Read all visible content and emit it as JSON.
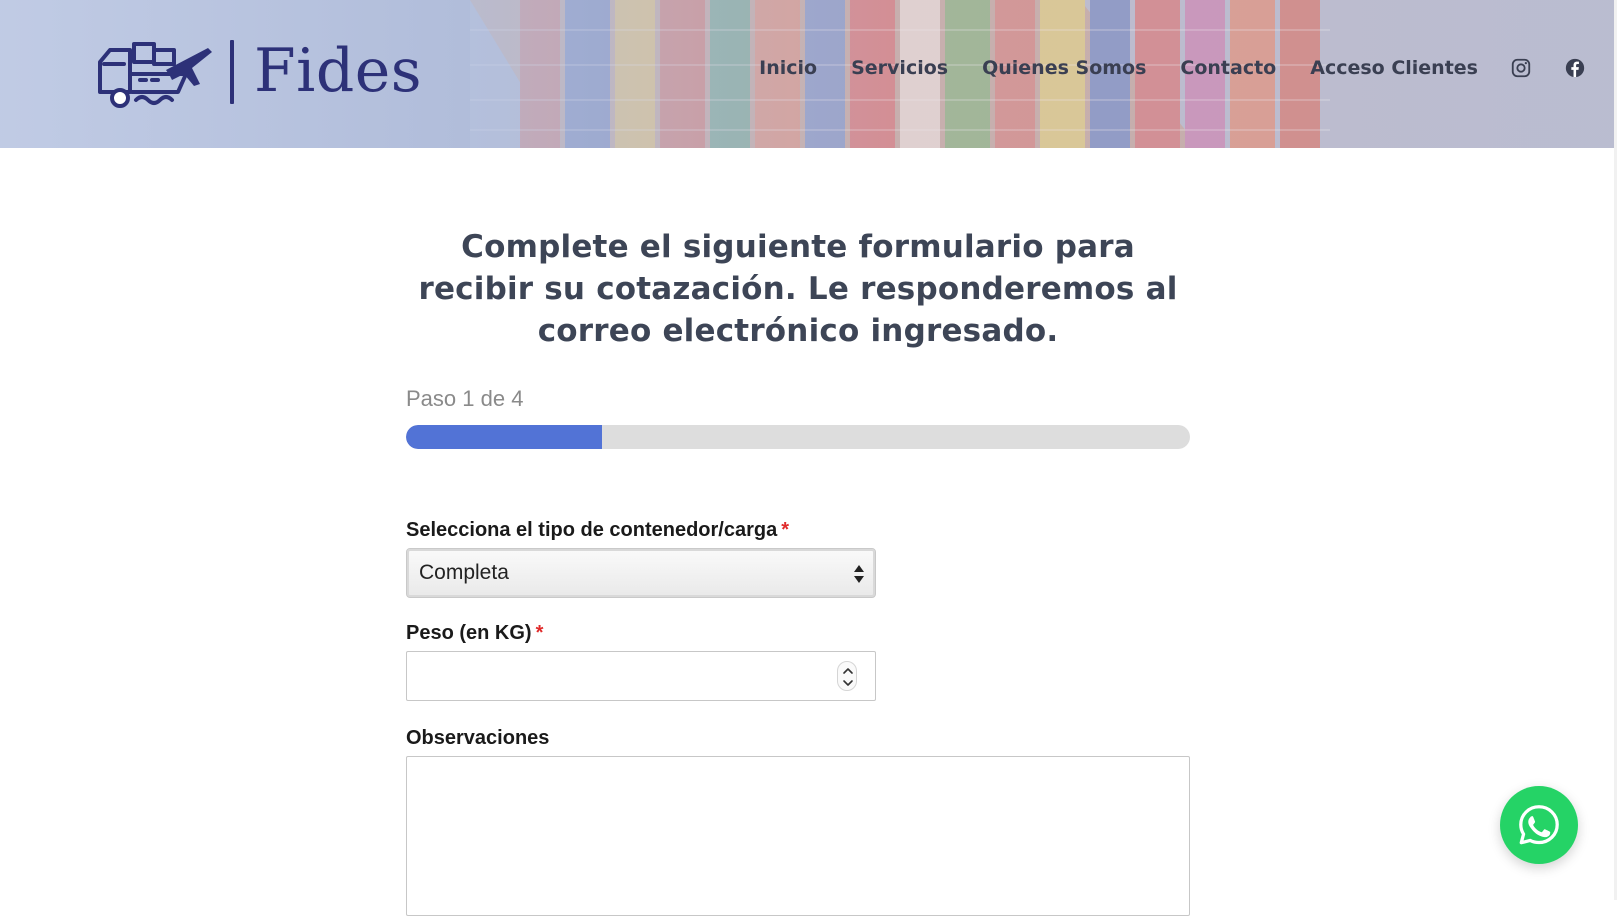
{
  "brand": {
    "name": "Fides",
    "primary_color": "#2d3178",
    "logo_icon": "truck-ship-plane-logo"
  },
  "nav": {
    "items": [
      {
        "label": "Inicio"
      },
      {
        "label": "Servicios"
      },
      {
        "label": "Quienes Somos"
      },
      {
        "label": "Contacto"
      },
      {
        "label": "Acceso Clientes"
      }
    ],
    "social_icons": [
      "instagram-icon",
      "facebook-icon"
    ]
  },
  "form": {
    "intro": "Complete el siguiente formulario para recibir su cotazación. Le responderemos al correo electrónico ingresado.",
    "step_label": "Paso 1 de 4",
    "progress_fraction": 0.25,
    "progress_color": "#5273d6",
    "container_type": {
      "label": "Selecciona el tipo de contenedor/carga",
      "required_mark": "*",
      "value": "Completa"
    },
    "weight": {
      "label": "Peso (en KG)",
      "required_mark": "*",
      "value": ""
    },
    "notes": {
      "label": "Observaciones",
      "value": ""
    }
  },
  "whatsapp": {
    "icon": "whatsapp-icon",
    "color": "#25d366"
  }
}
